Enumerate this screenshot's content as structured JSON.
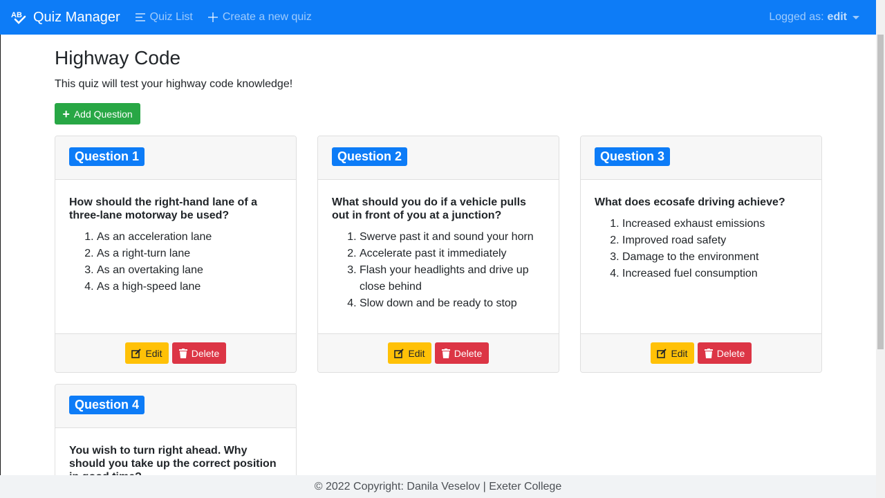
{
  "navbar": {
    "brand": "Quiz Manager",
    "links": [
      {
        "label": "Quiz List",
        "icon": "list-icon"
      },
      {
        "label": "Create a new quiz",
        "icon": "plus-icon"
      }
    ],
    "user_prefix": "Logged as:",
    "user_name": "edit"
  },
  "quiz": {
    "title": "Highway Code",
    "description": "This quiz will test your highway code knowledge!",
    "add_label": "Add Question"
  },
  "buttons": {
    "edit": "Edit",
    "delete": "Delete"
  },
  "questions": [
    {
      "badge": "Question 1",
      "text": "How should the right-hand lane of a three-lane motorway be used?",
      "answers": [
        "As an acceleration lane",
        "As a right-turn lane",
        "As an overtaking lane",
        "As a high-speed lane"
      ]
    },
    {
      "badge": "Question 2",
      "text": "What should you do if a vehicle pulls out in front of you at a junction?",
      "answers": [
        "Swerve past it and sound your horn",
        "Accelerate past it immediately",
        "Flash your headlights and drive up close behind",
        "Slow down and be ready to stop"
      ]
    },
    {
      "badge": "Question 3",
      "text": "What does ecosafe driving achieve?",
      "answers": [
        "Increased exhaust emissions",
        "Improved road safety",
        "Damage to the environment",
        "Increased fuel consumption"
      ]
    },
    {
      "badge": "Question 4",
      "text": "You wish to turn right ahead. Why should you take up the correct position in good time?",
      "answers": []
    }
  ],
  "footer": {
    "text": "© 2022 Copyright: Danila Veselov | Exeter College"
  },
  "colors": {
    "primary": "#0d7cf7",
    "success": "#28a745",
    "warning": "#ffc107",
    "danger": "#dc3545"
  }
}
